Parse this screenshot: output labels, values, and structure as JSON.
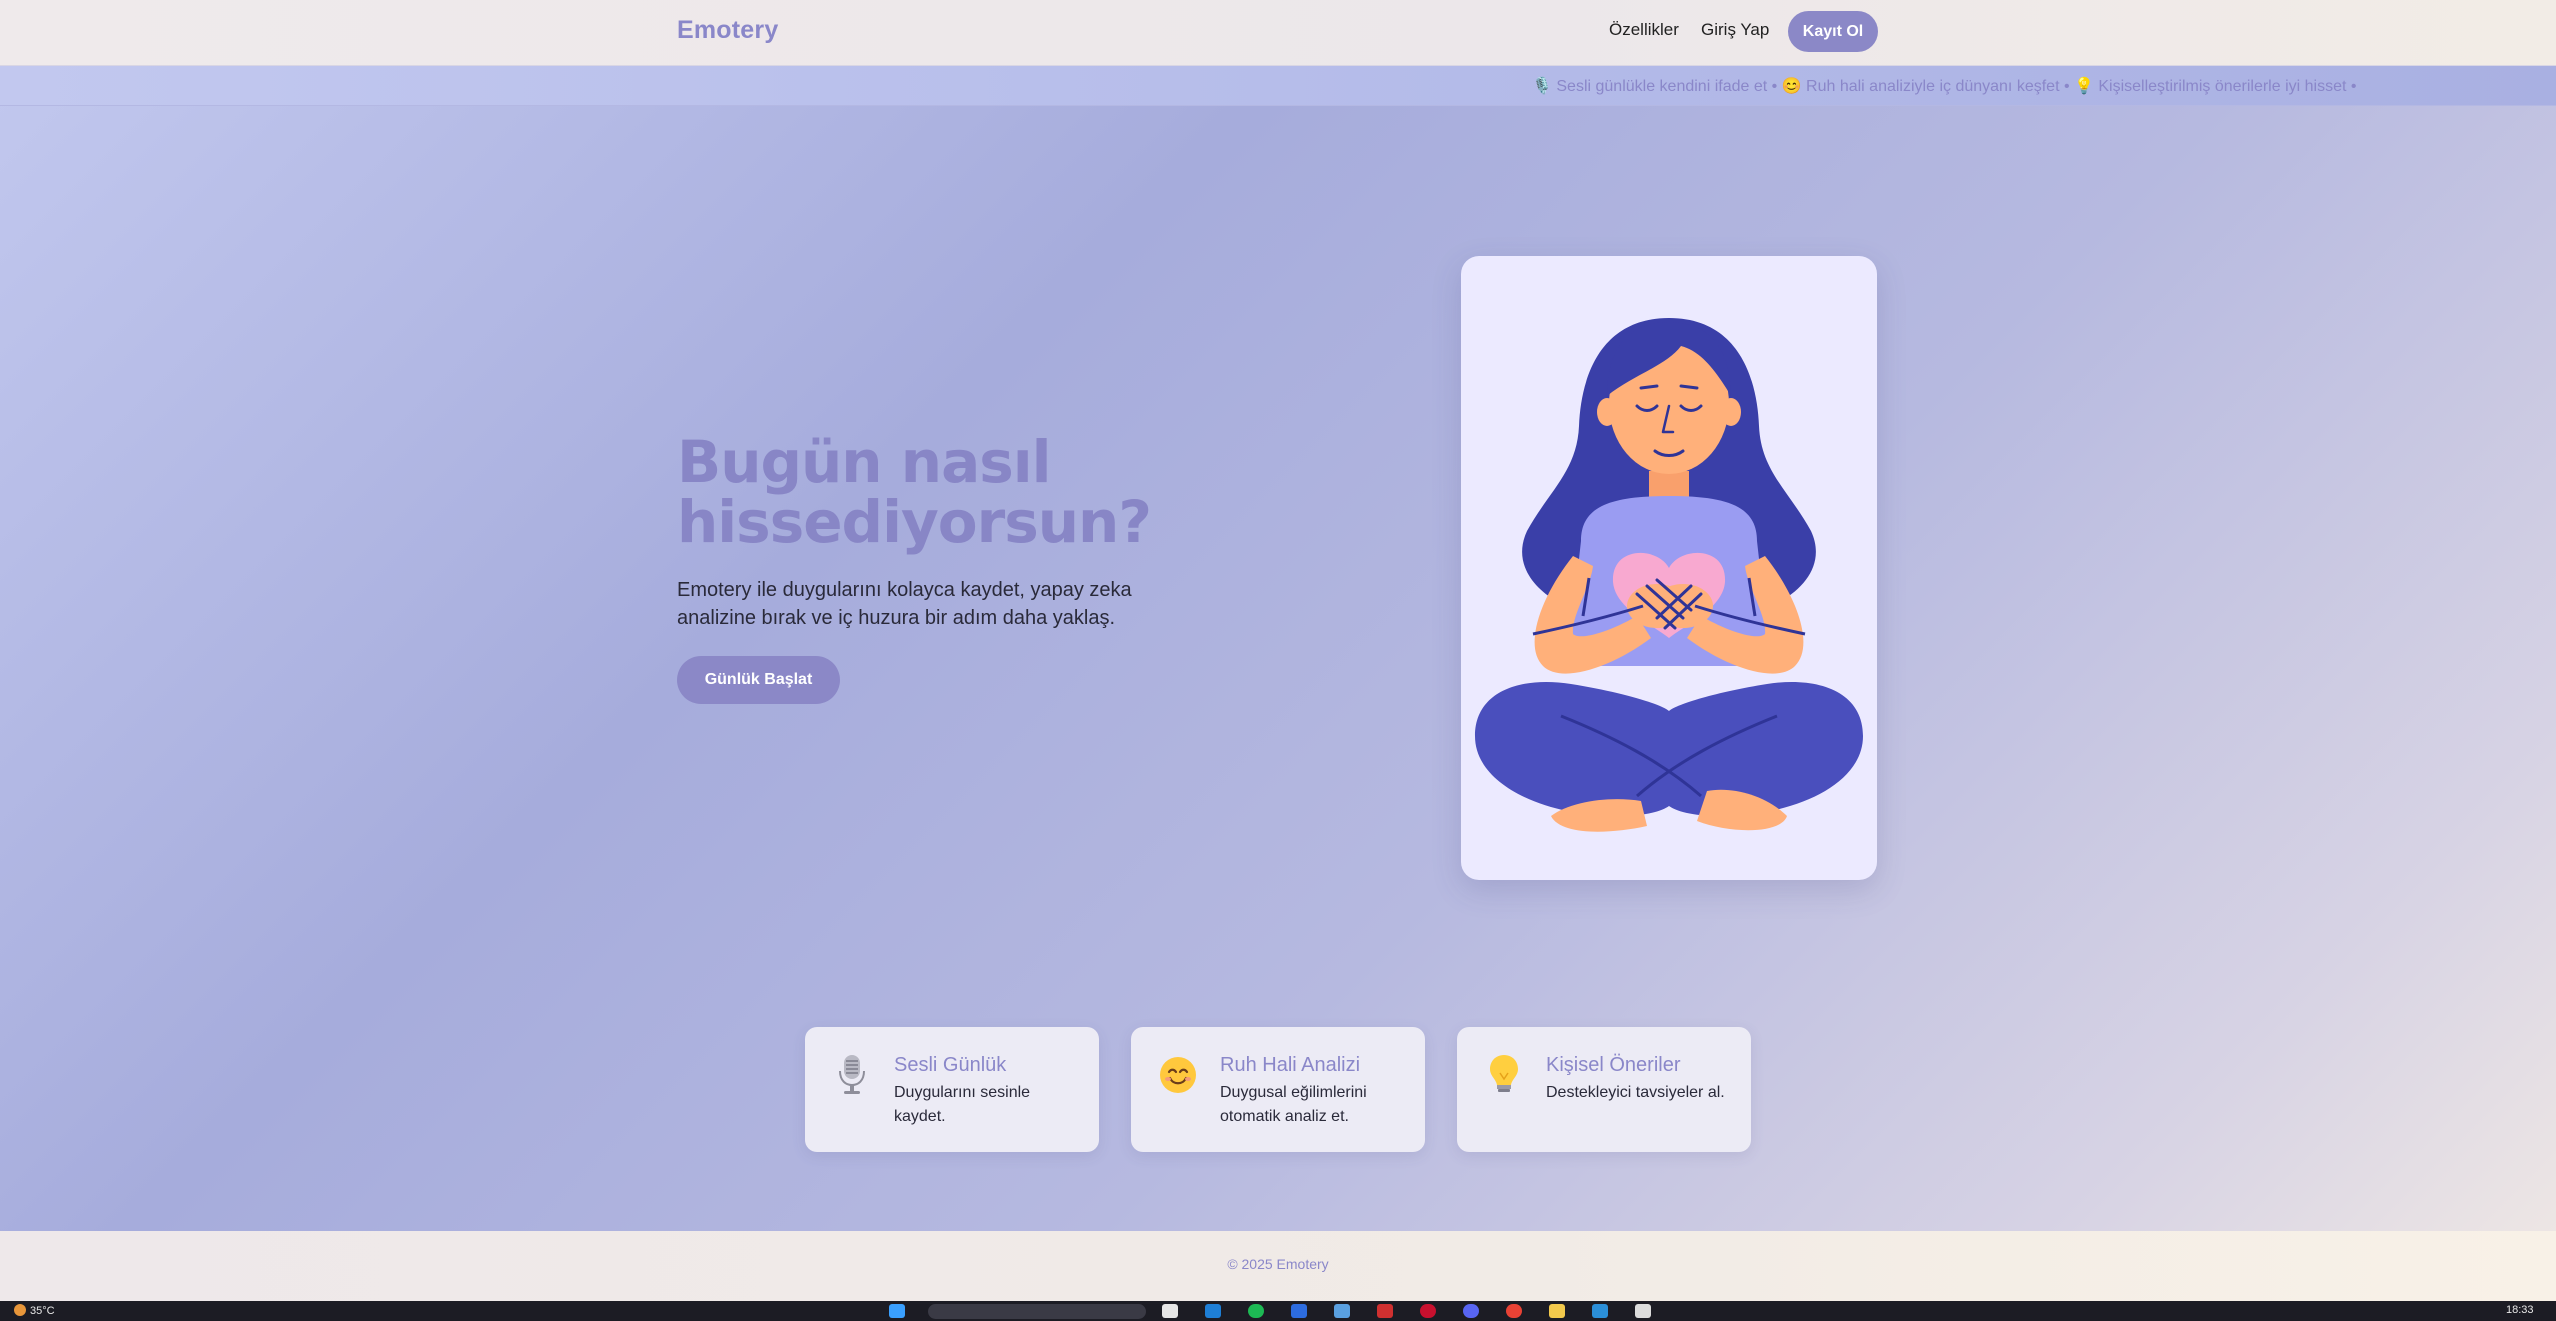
{
  "header": {
    "logo": "Emotery",
    "nav": {
      "features": "Özellikler",
      "login": "Giriş Yap",
      "register": "Kayıt Ol"
    }
  },
  "ticker": {
    "text": "🎙️ Sesli günlükle kendini ifade et • 😊 Ruh hali analiziyle iç dünyanı keşfet • 💡 Kişiselleştirilmiş önerilerle iyi hisset •"
  },
  "hero": {
    "title": "Bugün nasıl hissediyorsun?",
    "subtitle": "Emotery ile duygularını kolayca kaydet, yapay zeka analizine bırak ve iç huzura bir adım daha yaklaş.",
    "cta": "Günlük Başlat"
  },
  "features": [
    {
      "icon": "microphone-icon",
      "title": "Sesli Günlük",
      "desc": "Duygularını sesinle kaydet."
    },
    {
      "icon": "smiley-icon",
      "title": "Ruh Hali Analizi",
      "desc": "Duygusal eğilimlerini otomatik analiz et."
    },
    {
      "icon": "lightbulb-icon",
      "title": "Kişisel Öneriler",
      "desc": "Destekleyici tavsiyeler al."
    }
  ],
  "footer": {
    "text": "© 2025 Emotery"
  },
  "taskbar": {
    "weather": "35°C",
    "time": "18:33"
  },
  "colors": {
    "accent": "#8b88c7",
    "hair": "#3a3fa8",
    "skin": "#ffb07a",
    "shirt": "#9a9cf2",
    "pants": "#4a4fbd",
    "heart": "#f8a9d0"
  }
}
